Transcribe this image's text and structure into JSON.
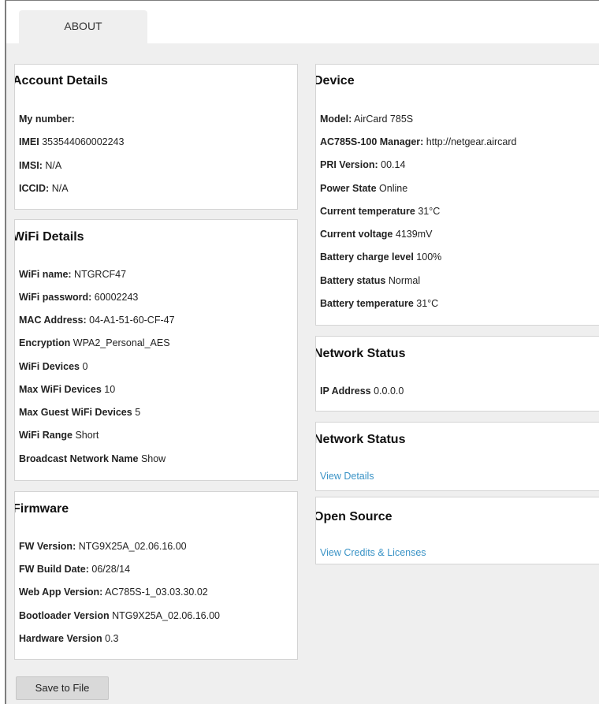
{
  "tabs": [
    {
      "label": "ABOUT"
    }
  ],
  "account": {
    "title": "Account Details",
    "rows": [
      {
        "key": "My number:",
        "value": ""
      },
      {
        "key": "IMEI",
        "value": "353544060002243"
      },
      {
        "key": "IMSI:",
        "value": "N/A"
      },
      {
        "key": "ICCID:",
        "value": "N/A"
      }
    ]
  },
  "wifi": {
    "title": "WiFi Details",
    "rows": [
      {
        "key": "WiFi name:",
        "value": "NTGRCF47"
      },
      {
        "key": "WiFi password:",
        "value": "60002243"
      },
      {
        "key": "MAC Address:",
        "value": "04-A1-51-60-CF-47"
      },
      {
        "key": "Encryption",
        "value": "WPA2_Personal_AES"
      },
      {
        "key": "WiFi Devices",
        "value": "0"
      },
      {
        "key": "Max WiFi Devices",
        "value": "10"
      },
      {
        "key": "Max Guest WiFi Devices",
        "value": "5"
      },
      {
        "key": "WiFi Range",
        "value": "Short"
      },
      {
        "key": "Broadcast Network Name",
        "value": "Show"
      }
    ]
  },
  "firmware": {
    "title": "Firmware",
    "rows": [
      {
        "key": "FW Version:",
        "value": "NTG9X25A_02.06.16.00"
      },
      {
        "key": "FW Build Date:",
        "value": "06/28/14"
      },
      {
        "key": "Web App Version:",
        "value": "AC785S-1_03.03.30.02"
      },
      {
        "key": "Bootloader Version",
        "value": "NTG9X25A_02.06.16.00"
      },
      {
        "key": "Hardware Version",
        "value": "0.3"
      }
    ]
  },
  "device": {
    "title": "Device",
    "rows": [
      {
        "key": "Model:",
        "value": "AirCard 785S"
      },
      {
        "key": "AC785S-100 Manager:",
        "value": "http://netgear.aircard"
      },
      {
        "key": "PRI Version:",
        "value": "00.14"
      },
      {
        "key": "Power State",
        "value": "Online"
      },
      {
        "key": "Current temperature",
        "value": "31°C"
      },
      {
        "key": "Current voltage",
        "value": "4139mV"
      },
      {
        "key": "Battery charge level",
        "value": "100%"
      },
      {
        "key": "Battery status",
        "value": "Normal"
      },
      {
        "key": "Battery temperature",
        "value": "31°C"
      }
    ]
  },
  "network_status": {
    "title": "Network Status",
    "rows": [
      {
        "key": "IP Address",
        "value": "0.0.0.0"
      }
    ]
  },
  "network_status_2": {
    "title": "Network Status",
    "link": "View Details"
  },
  "open_source": {
    "title": "Open Source",
    "link": "View Credits & Licenses"
  },
  "save_button": {
    "label": "Save to File"
  },
  "colors": {
    "link": "#3a93c6",
    "background": "#efefef",
    "panel": "#ffffff"
  }
}
